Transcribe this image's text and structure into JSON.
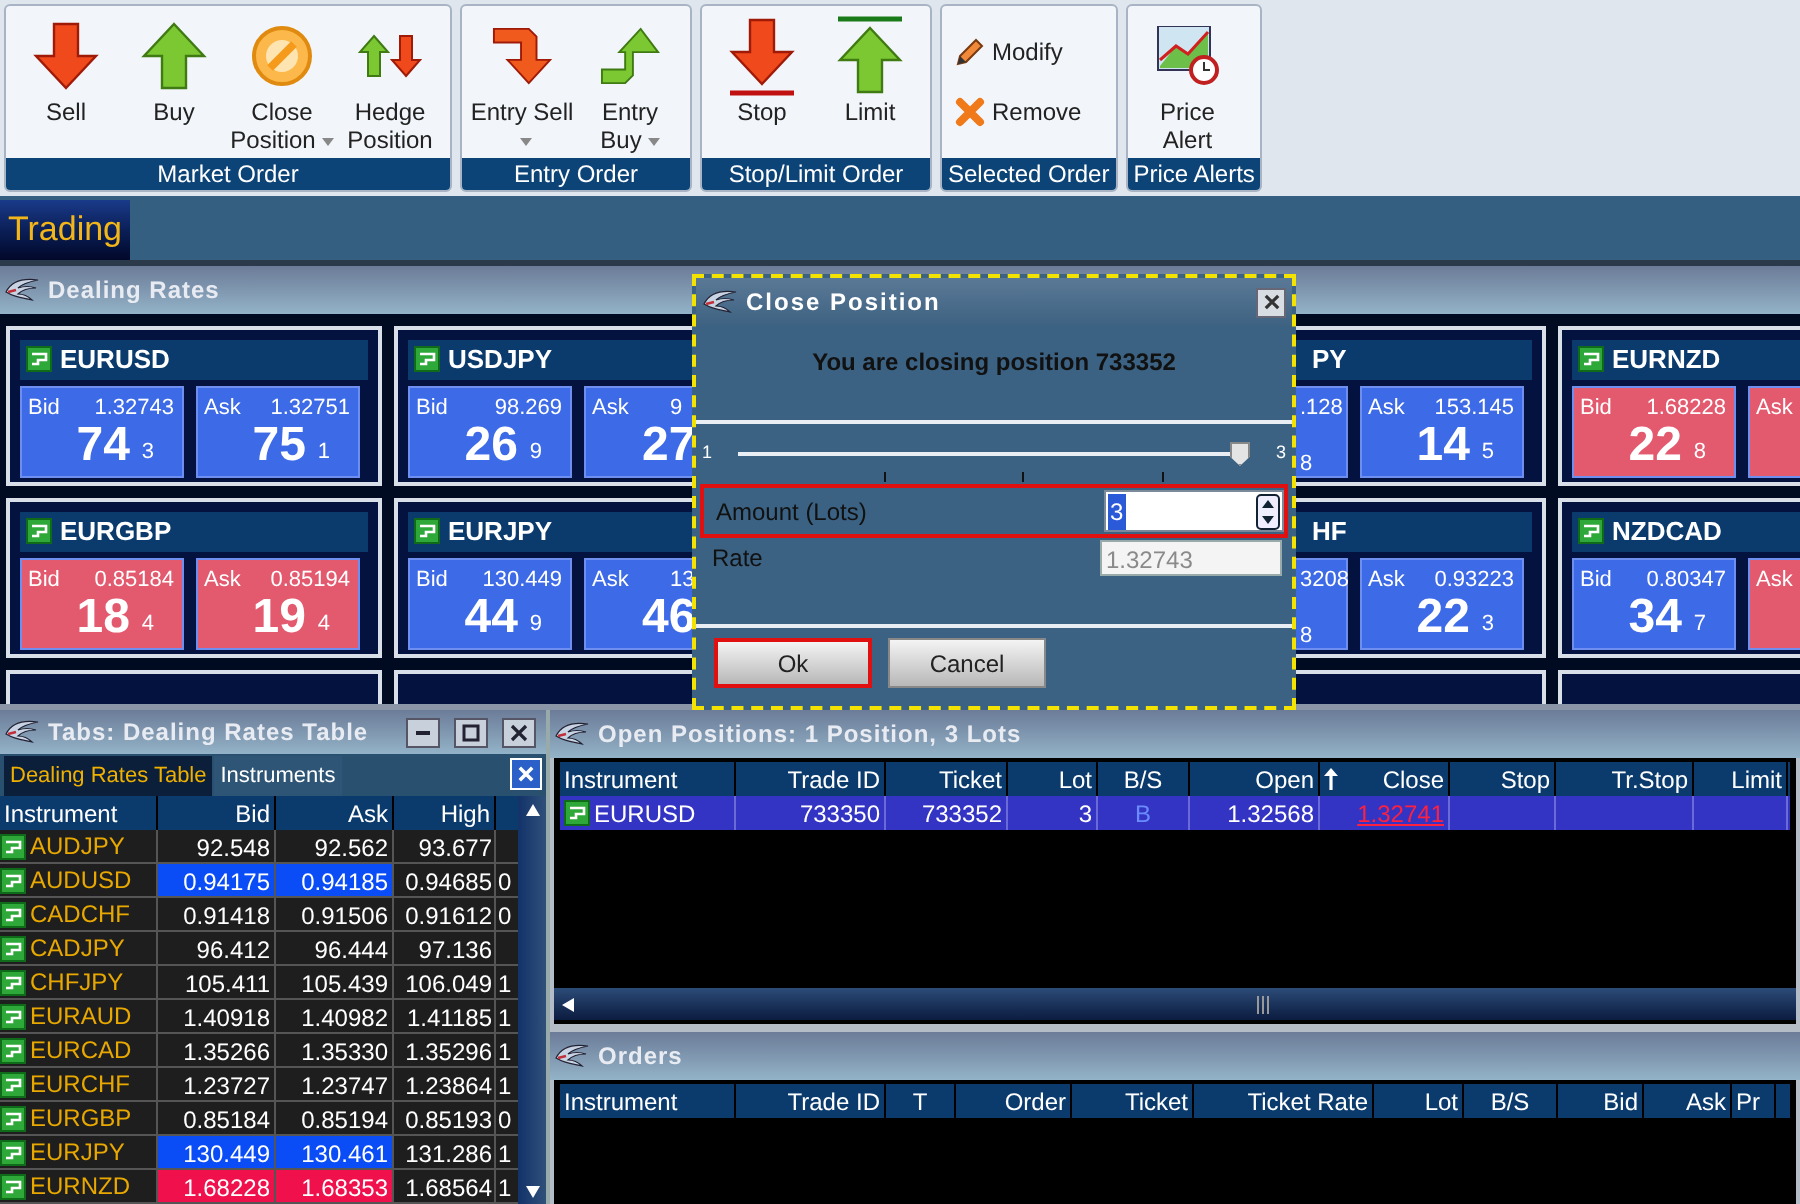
{
  "toolbar": {
    "groups": [
      {
        "label": "Market Order",
        "buttons": [
          {
            "label": "Sell",
            "kind": "large",
            "dropdown": false
          },
          {
            "label": "Buy",
            "kind": "large",
            "dropdown": false
          },
          {
            "label": "Close Position",
            "kind": "large",
            "dropdown": true
          },
          {
            "label": "Hedge Position",
            "kind": "large",
            "dropdown": false
          }
        ]
      },
      {
        "label": "Entry Order",
        "buttons": [
          {
            "label": "Entry Sell",
            "kind": "large",
            "dropdown": true
          },
          {
            "label": "Entry Buy",
            "kind": "large",
            "dropdown": true
          }
        ]
      },
      {
        "label": "Stop/Limit Order",
        "buttons": [
          {
            "label": "Stop",
            "kind": "large",
            "dropdown": false
          },
          {
            "label": "Limit",
            "kind": "large",
            "dropdown": false
          }
        ]
      },
      {
        "label": "Selected Order",
        "buttons": [
          {
            "label": "Modify",
            "kind": "small"
          },
          {
            "label": "Remove",
            "kind": "small"
          }
        ]
      },
      {
        "label": "Price Alerts",
        "buttons": [
          {
            "label": "Price Alert",
            "kind": "large",
            "dropdown": false
          }
        ]
      }
    ]
  },
  "tabs": [
    {
      "label": "Trading",
      "selected": true
    }
  ],
  "dealing_rates": {
    "title": "Dealing Rates",
    "rows": [
      [
        {
          "kind": "full",
          "name": "EURUSD",
          "bid": {
            "label": "Bid",
            "value": "1.32743",
            "big": "74",
            "small": "3",
            "color": "#3d6ae6"
          },
          "ask": {
            "label": "Ask",
            "value": "1.32751",
            "big": "75",
            "small": "1",
            "color": "#3d6ae6"
          }
        },
        {
          "kind": "partial",
          "name": "USDJPY",
          "bid": {
            "label": "Bid",
            "value": "98.269",
            "big": "26",
            "small": "9",
            "color": "#3d6ae6"
          },
          "ask": {
            "label": "Ask",
            "value": "9",
            "big": "27",
            "color": "#3d6ae6"
          }
        },
        {
          "kind": "hidden"
        },
        {
          "kind": "clipped",
          "name": "PY",
          "bid": {
            "value": ".128",
            "small": "8",
            "color": "#3d6ae6"
          },
          "ask": {
            "label": "Ask",
            "value": "153.145",
            "big": "14",
            "small": "5",
            "color": "#3d6ae6"
          }
        },
        {
          "kind": "full",
          "name": "EURNZD",
          "bid": {
            "label": "Bid",
            "value": "1.68228",
            "big": "22",
            "small": "8",
            "color": "#e35a6f"
          },
          "ask": {
            "label": "Ask",
            "color": "#e35a6f"
          }
        }
      ],
      [
        {
          "kind": "full",
          "name": "EURGBP",
          "bid": {
            "label": "Bid",
            "value": "0.85184",
            "big": "18",
            "small": "4",
            "color": "#e35a6f"
          },
          "ask": {
            "label": "Ask",
            "value": "0.85194",
            "big": "19",
            "small": "4",
            "color": "#e35a6f"
          }
        },
        {
          "kind": "partial",
          "name": "EURJPY",
          "bid": {
            "label": "Bid",
            "value": "130.449",
            "big": "44",
            "small": "9",
            "color": "#3d6ae6"
          },
          "ask": {
            "label": "Ask",
            "value": "13",
            "big": "46",
            "color": "#3d6ae6"
          }
        },
        {
          "kind": "hidden"
        },
        {
          "kind": "clipped",
          "name": "HF",
          "bid": {
            "value": "3208",
            "small": "8",
            "color": "#3d6ae6"
          },
          "ask": {
            "label": "Ask",
            "value": "0.93223",
            "big": "22",
            "small": "3",
            "color": "#3d6ae6"
          }
        },
        {
          "kind": "full",
          "name": "NZDCAD",
          "bid": {
            "label": "Bid",
            "value": "0.80347",
            "big": "34",
            "small": "7",
            "color": "#3d6ae6"
          },
          "ask": {
            "label": "Ask",
            "color": "#e35a6f"
          }
        }
      ]
    ]
  },
  "dialog": {
    "title": "Close Position",
    "message": "You are closing position 733352",
    "slider": {
      "min": "1",
      "max": "3",
      "level": 1
    },
    "amount": {
      "label": "Amount (Lots)",
      "value": "3"
    },
    "rate": {
      "label": "Rate",
      "value": "1.32743",
      "disabled": true
    },
    "buttons": [
      {
        "label": "Ok",
        "focused": true
      },
      {
        "label": "Cancel",
        "focused": false
      }
    ]
  },
  "rates_table": {
    "title": "Tabs: Dealing Rates Table",
    "tabs": [
      {
        "label": "Dealing Rates Table",
        "selected": true
      },
      {
        "label": "Instruments",
        "selected": false
      }
    ],
    "columns": [
      "Instrument",
      "Bid",
      "Ask",
      "High"
    ],
    "rows": [
      {
        "instrument": "AUDJPY",
        "bid": "92.548",
        "ask": "92.562",
        "high": "93.677"
      },
      {
        "instrument": "AUDUSD",
        "bid": "0.94175",
        "ask": "0.94185",
        "high": "0.94685",
        "column_5": "0",
        "color": "#0a4cf6"
      },
      {
        "instrument": "CADCHF",
        "bid": "0.91418",
        "ask": "0.91506",
        "high": "0.91612",
        "column_5": "0"
      },
      {
        "instrument": "CADJPY",
        "bid": "96.412",
        "ask": "96.444",
        "high": "97.136"
      },
      {
        "instrument": "CHFJPY",
        "bid": "105.411",
        "ask": "105.439",
        "high": "106.049",
        "column_5": "1"
      },
      {
        "instrument": "EURAUD",
        "bid": "1.40918",
        "ask": "1.40982",
        "high": "1.41185",
        "column_5": "1"
      },
      {
        "instrument": "EURCAD",
        "bid": "1.35266",
        "ask": "1.35330",
        "high": "1.35296",
        "column_5": "1"
      },
      {
        "instrument": "EURCHF",
        "bid": "1.23727",
        "ask": "1.23747",
        "high": "1.23864",
        "column_5": "1"
      },
      {
        "instrument": "EURGBP",
        "bid": "0.85184",
        "ask": "0.85194",
        "high": "0.85193",
        "column_5": "0"
      },
      {
        "instrument": "EURJPY",
        "bid": "130.449",
        "ask": "130.461",
        "high": "131.286",
        "column_5": "1",
        "color": "#0a4cf6"
      },
      {
        "instrument": "EURNZD",
        "bid": "1.68228",
        "ask": "1.68353",
        "high": "1.68564",
        "column_5": "1",
        "color": "#f0104c"
      }
    ]
  },
  "open_positions": {
    "title": "Open Positions: 1 Position, 3 Lots",
    "columns": [
      "Instrument",
      "Trade ID",
      "Ticket",
      "Lot",
      "B/S",
      "Open",
      "Close",
      "Stop",
      "Tr.Stop",
      "Limit"
    ],
    "rows": [
      {
        "selected": true,
        "cells": [
          "EURUSD",
          "733350",
          "733352",
          "3",
          "B",
          "1.32568",
          "1.32741",
          "",
          "",
          ""
        ]
      }
    ]
  },
  "orders": {
    "title": "Orders",
    "columns": [
      "Instrument",
      "Trade ID",
      "T",
      "Order",
      "Ticket",
      "Ticket Rate",
      "Lot",
      "B/S",
      "Bid",
      "Ask",
      "Pr"
    ]
  }
}
